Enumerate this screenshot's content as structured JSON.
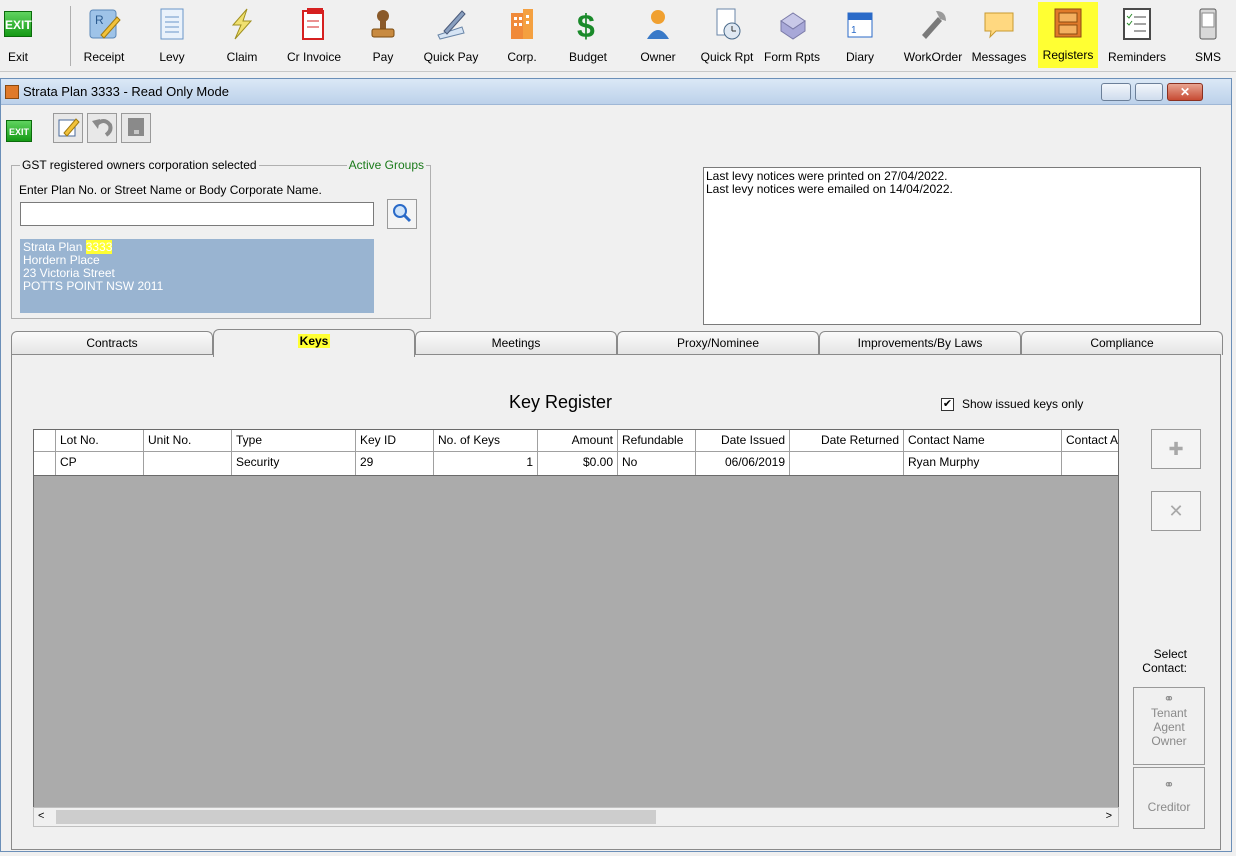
{
  "toolbar": {
    "items": [
      {
        "label": "Exit"
      },
      {
        "label": "Receipt"
      },
      {
        "label": "Levy"
      },
      {
        "label": "Claim"
      },
      {
        "label": "Cr Invoice"
      },
      {
        "label": "Pay"
      },
      {
        "label": "Quick Pay"
      },
      {
        "label": "Corp."
      },
      {
        "label": "Budget"
      },
      {
        "label": "Owner"
      },
      {
        "label": "Quick Rpt"
      },
      {
        "label": "Form Rpts"
      },
      {
        "label": "Diary"
      },
      {
        "label": "WorkOrder"
      },
      {
        "label": "Messages"
      },
      {
        "label": "Registers"
      },
      {
        "label": "Reminders"
      },
      {
        "label": "SMS"
      }
    ],
    "exit_icon_text": "EXIT"
  },
  "window": {
    "title": "Strata Plan 3333 - Read Only Mode",
    "exit_small": "EXIT"
  },
  "search": {
    "group_label": "GST registered owners corporation selected",
    "active_groups": "Active Groups",
    "prompt": "Enter Plan No. or Street Name or Body Corporate Name.",
    "value": ""
  },
  "plan": {
    "prefix": "Strata Plan ",
    "number": "3333",
    "line2": "Hordern Place",
    "line3": "23 Victoria Street",
    "line4": "POTTS POINT  NSW  2011"
  },
  "notices": {
    "line1": "Last levy notices were printed on 27/04/2022.",
    "line2": "Last levy notices were emailed on 14/04/2022."
  },
  "tabs": [
    "Contracts",
    "Keys",
    "Meetings",
    "Proxy/Nominee",
    "Improvements/By Laws",
    "Compliance"
  ],
  "register": {
    "title": "Key Register",
    "show_issued_label": "Show issued keys only",
    "show_issued_checked": true,
    "columns": [
      "Lot No.",
      "Unit No.",
      "Type",
      "Key ID",
      "No. of Keys",
      "Amount",
      "Refundable",
      "Date Issued",
      "Date Returned",
      "Contact Name",
      "Contact Ad"
    ],
    "rows": [
      [
        "CP",
        "",
        "Security",
        "29",
        "1",
        "$0.00",
        "No",
        "06/06/2019",
        "",
        "Ryan Murphy",
        ""
      ]
    ]
  },
  "side": {
    "select_contact_1": "Select",
    "select_contact_2": "Contact:",
    "contact_line1": "Tenant",
    "contact_line2": "Agent",
    "contact_line3": "Owner",
    "creditor": "Creditor"
  }
}
